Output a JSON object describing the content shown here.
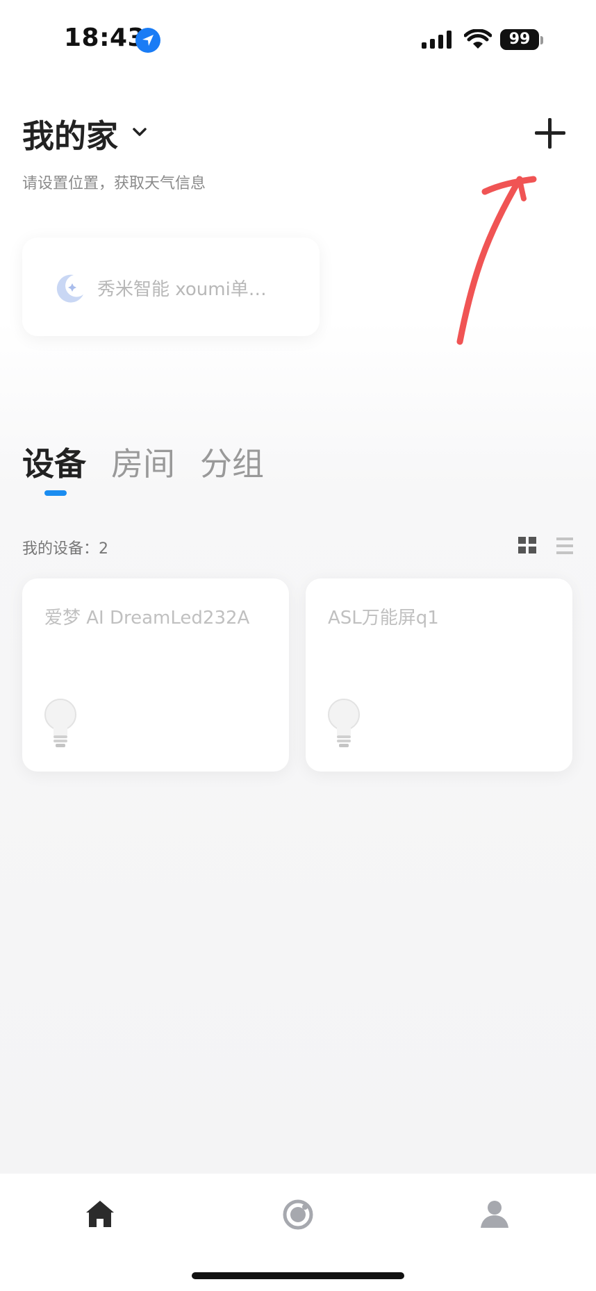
{
  "status_bar": {
    "time": "18:43",
    "battery": "99"
  },
  "header": {
    "home_name": "我的家",
    "location_hint": "请设置位置，获取天气信息"
  },
  "scene_card": {
    "label": "秀米智能 xoumi单…"
  },
  "tabs": [
    {
      "label": "设备",
      "active": true
    },
    {
      "label": "房间",
      "active": false
    },
    {
      "label": "分组",
      "active": false
    }
  ],
  "devices": {
    "count_label": "我的设备：2",
    "items": [
      {
        "name": "爱梦 AI DreamLed232A",
        "icon": "lightbulb-icon"
      },
      {
        "name": "ASL万能屏q1",
        "icon": "lightbulb-icon"
      }
    ]
  },
  "bottom_nav": [
    {
      "icon": "home-icon",
      "active": true
    },
    {
      "icon": "scene-icon",
      "active": false
    },
    {
      "icon": "profile-icon",
      "active": false
    }
  ],
  "colors": {
    "accent": "#1a8cf0",
    "annotation": "#f05454",
    "location_badge": "#1a7cf5"
  }
}
